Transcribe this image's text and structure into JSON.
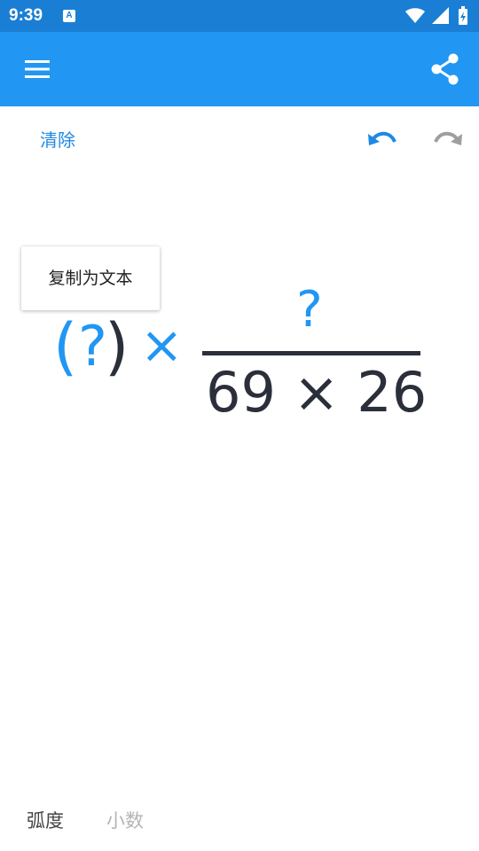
{
  "status_bar": {
    "time": "9:39",
    "notification_icon_letter": "A",
    "icons": [
      "wifi-icon",
      "signal-icon",
      "battery-icon"
    ]
  },
  "app_bar": {
    "color": "#2196f3",
    "status_color": "#1a7fd4",
    "menu_icon": "menu-icon",
    "share_icon": "share-icon"
  },
  "toolbar": {
    "clear_label": "清除",
    "undo_icon": "undo-icon",
    "redo_icon": "redo-icon"
  },
  "popup": {
    "copy_as_text_label": "复制为文本"
  },
  "expression": {
    "open_paren": "(",
    "placeholder": "?",
    "close_paren": ")",
    "times": "×",
    "numerator": "?",
    "denominator": "69 × 26",
    "accent_color": "#2196f3",
    "ink_color": "#2a2f3a"
  },
  "modes": {
    "radian_label": "弧度",
    "decimal_label": "小数"
  }
}
